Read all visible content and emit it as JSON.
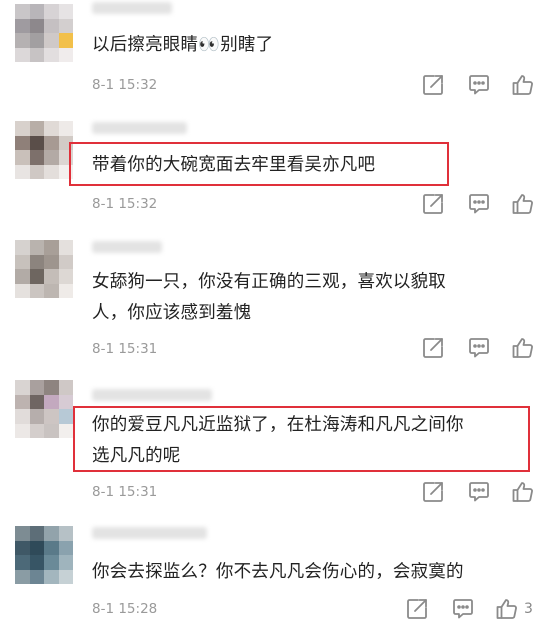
{
  "comments": [
    {
      "text_lines": [
        "以后擦亮眼睛👀别瞎了"
      ],
      "time": "8-1 15:32",
      "likes": "",
      "avatar_colors": [
        "#c9c6c8",
        "#b8b5b9",
        "#d7d3d5",
        "#e6e3e4",
        "#9f9ba0",
        "#8d888c",
        "#c5c0c2",
        "#d3cfcf",
        "#b5b1b2",
        "#a29fa1",
        "#cfc9c8",
        "#f2c04a",
        "#dcd8d9",
        "#c7c3c4",
        "#e2dedf",
        "#f0ecec"
      ]
    },
    {
      "text_lines": [
        "带着你的大碗宽面去牢里看吴亦凡吧"
      ],
      "time": "8-1 15:32",
      "likes": "",
      "highlighted": true,
      "avatar_colors": [
        "#d8d1cc",
        "#b8aea7",
        "#e0dad6",
        "#eeeae8",
        "#8f8079",
        "#5a4e49",
        "#a79a93",
        "#d2cbc6",
        "#c9c0ba",
        "#7d706b",
        "#b3aaa5",
        "#dcd6d2",
        "#e8e4e2",
        "#cfc8c4",
        "#e3dedb",
        "#f3f0ee"
      ]
    },
    {
      "text_lines": [
        "女舔狗一只，你没有正确的三观，喜欢以貌取",
        "人，你应该感到羞愧"
      ],
      "time": "8-1 15:31",
      "likes": "",
      "avatar_colors": [
        "#d6d2cf",
        "#b9b3ae",
        "#a89f98",
        "#e4e0dd",
        "#c7c1bc",
        "#8c847e",
        "#9e958e",
        "#d1cbc7",
        "#b2aba6",
        "#6e6660",
        "#c4bdb8",
        "#ddd8d4",
        "#e5e1de",
        "#cbc5c1",
        "#bdb6b1",
        "#efebe8"
      ]
    },
    {
      "text_lines": [
        "你的爱豆凡凡近监狱了，在杜海涛和凡凡之间你",
        "选凡凡的呢"
      ],
      "time": "8-1 15:31",
      "likes": "",
      "highlighted": true,
      "avatar_colors": [
        "#d9d4d2",
        "#a9a09e",
        "#8e8480",
        "#cfc8c6",
        "#bdb3b0",
        "#6f6562",
        "#c3a9bf",
        "#d7cbd4",
        "#e1dcda",
        "#b6aeac",
        "#cdc5c3",
        "#b7c9d6",
        "#ece8e6",
        "#d4cecc",
        "#c9c3c1",
        "#f2efed"
      ]
    },
    {
      "text_lines": [
        "你会去探监么？你不去凡凡会伤心的，会寂寞的"
      ],
      "time": "8-1 15:28",
      "likes": "3",
      "avatar_colors": [
        "#7d8c93",
        "#5d6e78",
        "#92a3ab",
        "#b6c1c6",
        "#3f5866",
        "#2f4a59",
        "#5a7a89",
        "#8aa2ae",
        "#4c6978",
        "#375565",
        "#6a8a98",
        "#9fb4bd",
        "#8a9ca4",
        "#6c8593",
        "#a3b6be",
        "#c6d1d5"
      ]
    }
  ],
  "icons": {
    "share": "share-icon",
    "comment": "comment-icon",
    "like": "like-icon"
  },
  "colors": {
    "highlight_border": "#e0303a",
    "time_text": "#9a9a9a",
    "icon_stroke": "#8a8a8a"
  }
}
